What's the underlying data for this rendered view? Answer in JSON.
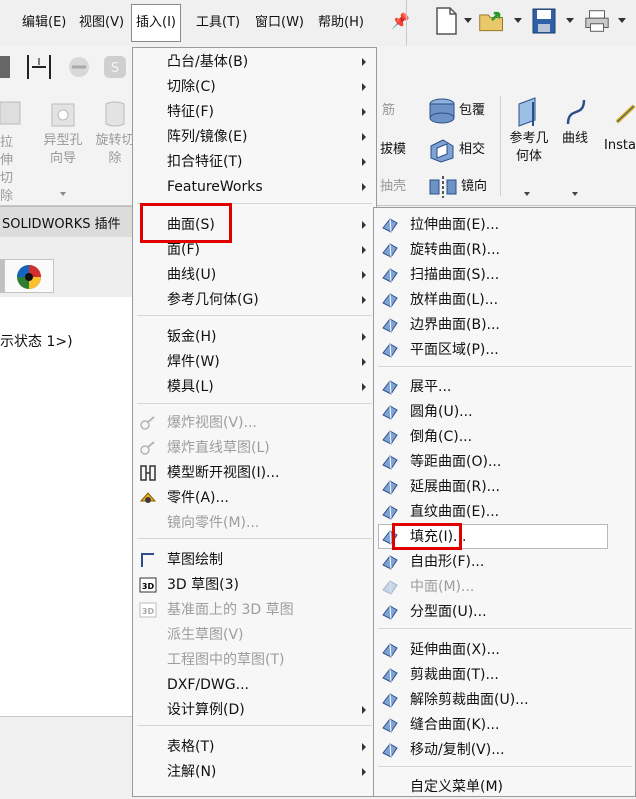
{
  "menubar": {
    "items": [
      {
        "label": "编辑(E)"
      },
      {
        "label": "视图(V)"
      },
      {
        "label": "插入(I)"
      },
      {
        "label": "工具(T)"
      },
      {
        "label": "窗口(W)"
      },
      {
        "label": "帮助(H)"
      }
    ]
  },
  "ribbon": {
    "left_features": [
      {
        "label": "拉伸切除"
      },
      {
        "label": "异型孔向导"
      },
      {
        "label": "旋转切除"
      }
    ],
    "mid_features": [
      {
        "label": "筋"
      },
      {
        "label": "拔模"
      },
      {
        "label": "抽壳"
      },
      {
        "label": "包覆"
      },
      {
        "label": "相交"
      },
      {
        "label": "镜向"
      }
    ],
    "right_features": [
      {
        "label": "参考几何体"
      },
      {
        "label": "曲线"
      },
      {
        "label": "Insta"
      }
    ]
  },
  "panel": {
    "tab_label": "SOLIDWORKS 插件",
    "tree_text": "示状态 1>)"
  },
  "insert_menu": {
    "items": [
      {
        "label": "凸台/基体(B)"
      },
      {
        "label": "切除(C)"
      },
      {
        "label": "特征(F)"
      },
      {
        "label": "阵列/镜像(E)"
      },
      {
        "label": "扣合特征(T)"
      },
      {
        "label": "FeatureWorks"
      },
      {
        "label": "曲面(S)"
      },
      {
        "label": "面(F)"
      },
      {
        "label": "曲线(U)"
      },
      {
        "label": "参考几何体(G)"
      },
      {
        "label": "钣金(H)"
      },
      {
        "label": "焊件(W)"
      },
      {
        "label": "模具(L)"
      },
      {
        "label": "爆炸视图(V)..."
      },
      {
        "label": "爆炸直线草图(L)"
      },
      {
        "label": "模型断开视图(I)..."
      },
      {
        "label": "零件(A)..."
      },
      {
        "label": "镜向零件(M)..."
      },
      {
        "label": "草图绘制"
      },
      {
        "label": "3D 草图(3)"
      },
      {
        "label": "基准面上的 3D 草图"
      },
      {
        "label": "派生草图(V)"
      },
      {
        "label": "工程图中的草图(T)"
      },
      {
        "label": "DXF/DWG..."
      },
      {
        "label": "设计算例(D)"
      },
      {
        "label": "表格(T)"
      },
      {
        "label": "注解(N)"
      }
    ]
  },
  "surface_menu": {
    "items": [
      {
        "label": "拉伸曲面(E)..."
      },
      {
        "label": "旋转曲面(R)..."
      },
      {
        "label": "扫描曲面(S)..."
      },
      {
        "label": "放样曲面(L)..."
      },
      {
        "label": "边界曲面(B)..."
      },
      {
        "label": "平面区域(P)..."
      },
      {
        "label": "展平..."
      },
      {
        "label": "圆角(U)..."
      },
      {
        "label": "倒角(C)..."
      },
      {
        "label": "等距曲面(O)..."
      },
      {
        "label": "延展曲面(R)..."
      },
      {
        "label": "直纹曲面(E)..."
      },
      {
        "label": "填充(I)..."
      },
      {
        "label": "自由形(F)..."
      },
      {
        "label": "中面(M)..."
      },
      {
        "label": "分型面(U)..."
      },
      {
        "label": "延伸曲面(X)..."
      },
      {
        "label": "剪裁曲面(T)..."
      },
      {
        "label": "解除剪裁曲面(U)..."
      },
      {
        "label": "缝合曲面(K)..."
      },
      {
        "label": "移动/复制(V)..."
      },
      {
        "label": "自定义菜单(M)"
      }
    ]
  },
  "colors": {
    "highlight": "#e00000",
    "accent": "#2a62c9"
  }
}
